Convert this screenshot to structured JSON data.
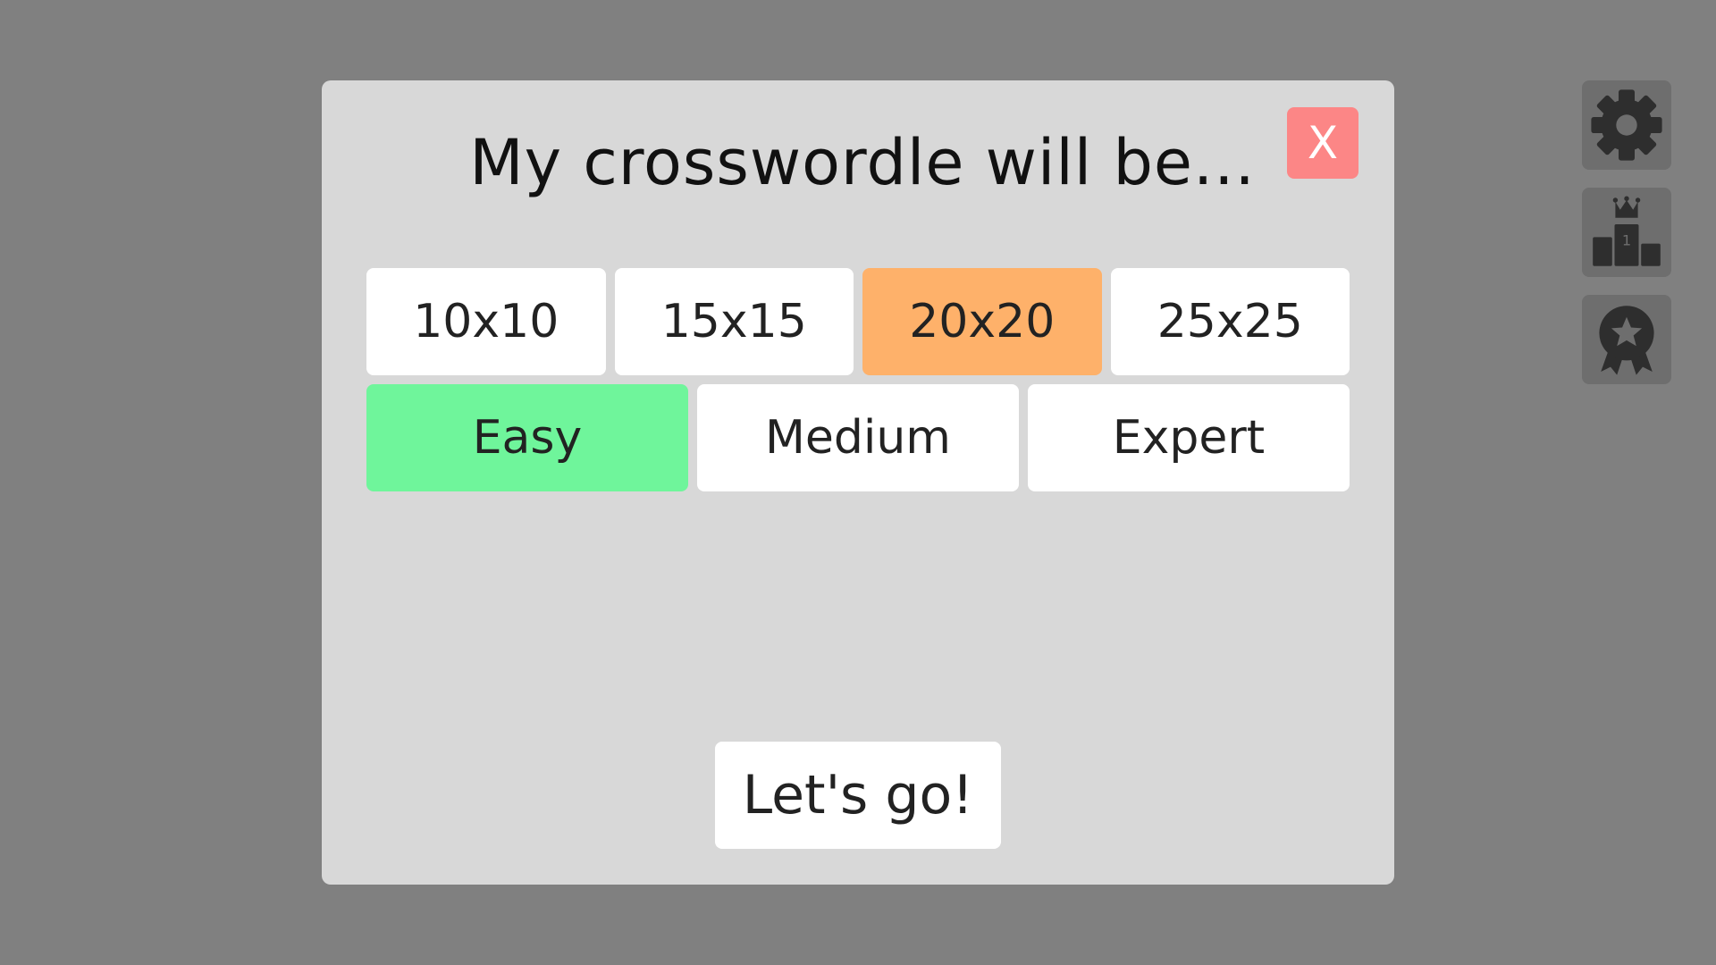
{
  "modal": {
    "title": "My crosswordle will be...",
    "close_label": "X",
    "sizes": [
      {
        "label": "10x10",
        "selected": false
      },
      {
        "label": "15x15",
        "selected": false
      },
      {
        "label": "20x20",
        "selected": true
      },
      {
        "label": "25x25",
        "selected": false
      }
    ],
    "difficulties": [
      {
        "label": "Easy",
        "selected": true
      },
      {
        "label": "Medium",
        "selected": false
      },
      {
        "label": "Expert",
        "selected": false
      }
    ],
    "go_label": "Let's go!"
  },
  "side_buttons": [
    {
      "icon": "gear-icon"
    },
    {
      "icon": "podium-crown-icon",
      "badge": "1"
    },
    {
      "icon": "award-ribbon-icon"
    }
  ],
  "colors": {
    "background": "#808080",
    "modal": "#d8d8d8",
    "close": "#fc8686",
    "selected_size": "#feb16a",
    "selected_difficulty": "#6ff59b",
    "icon": "#2e2e2e"
  }
}
